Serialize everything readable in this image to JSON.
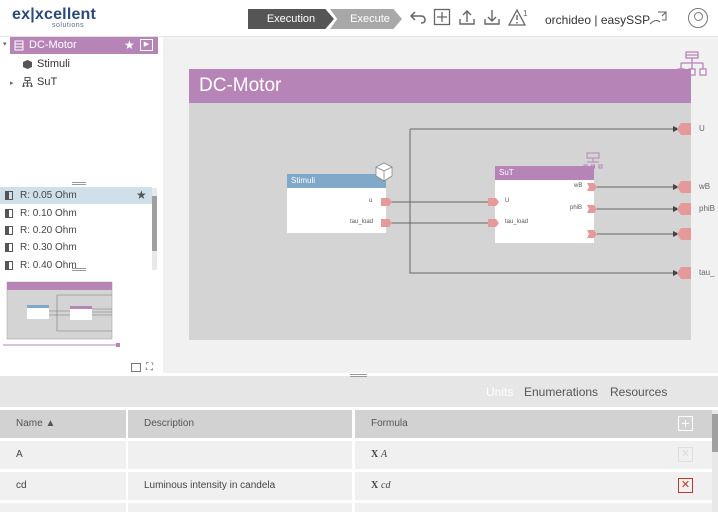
{
  "app": {
    "logo_main": "ex|xcellent",
    "logo_sub": "solutions",
    "product": "orchideo | easySSP"
  },
  "toolbar": {
    "execution_label": "Execution",
    "execute_label": "Execute",
    "alert_count": "1"
  },
  "tree": {
    "items": [
      {
        "label": "DC-Motor"
      },
      {
        "label": "Stimuli"
      },
      {
        "label": "SuT"
      }
    ]
  },
  "variants": {
    "items": [
      {
        "label": "R: 0.05 Ohm"
      },
      {
        "label": "R: 0.10 Ohm"
      },
      {
        "label": "R: 0.20 Ohm"
      },
      {
        "label": "R: 0.30 Ohm"
      },
      {
        "label": "R: 0.40 Ohm"
      }
    ]
  },
  "diagram": {
    "title": "DC-Motor",
    "stimuli": {
      "title": "Stimuli",
      "port_u": "u",
      "port_tau": "tau_load"
    },
    "sut": {
      "title": "SuT",
      "in_u": "U",
      "in_tau": "tau_load",
      "out_w": "wB",
      "out_phi": "phiB"
    },
    "outputs": [
      "U",
      "wB",
      "phiB",
      "tau_"
    ]
  },
  "bottom": {
    "tabs": [
      {
        "label": "Units"
      },
      {
        "label": "Enumerations"
      },
      {
        "label": "Resources"
      }
    ],
    "columns": [
      "Name ▲",
      "Description",
      "Formula"
    ],
    "rows": [
      {
        "name": "A",
        "description": "",
        "formula_prefix": "X",
        "formula_var": "A"
      },
      {
        "name": "cd",
        "description": "Luminous intensity in candela",
        "formula_prefix": "X",
        "formula_var": "cd"
      }
    ]
  },
  "colors": {
    "accent": "#b784b7",
    "stimuli_header": "#7fa8c9",
    "port": "#e59a9a",
    "diagram_bg": "#d4d4d4"
  }
}
